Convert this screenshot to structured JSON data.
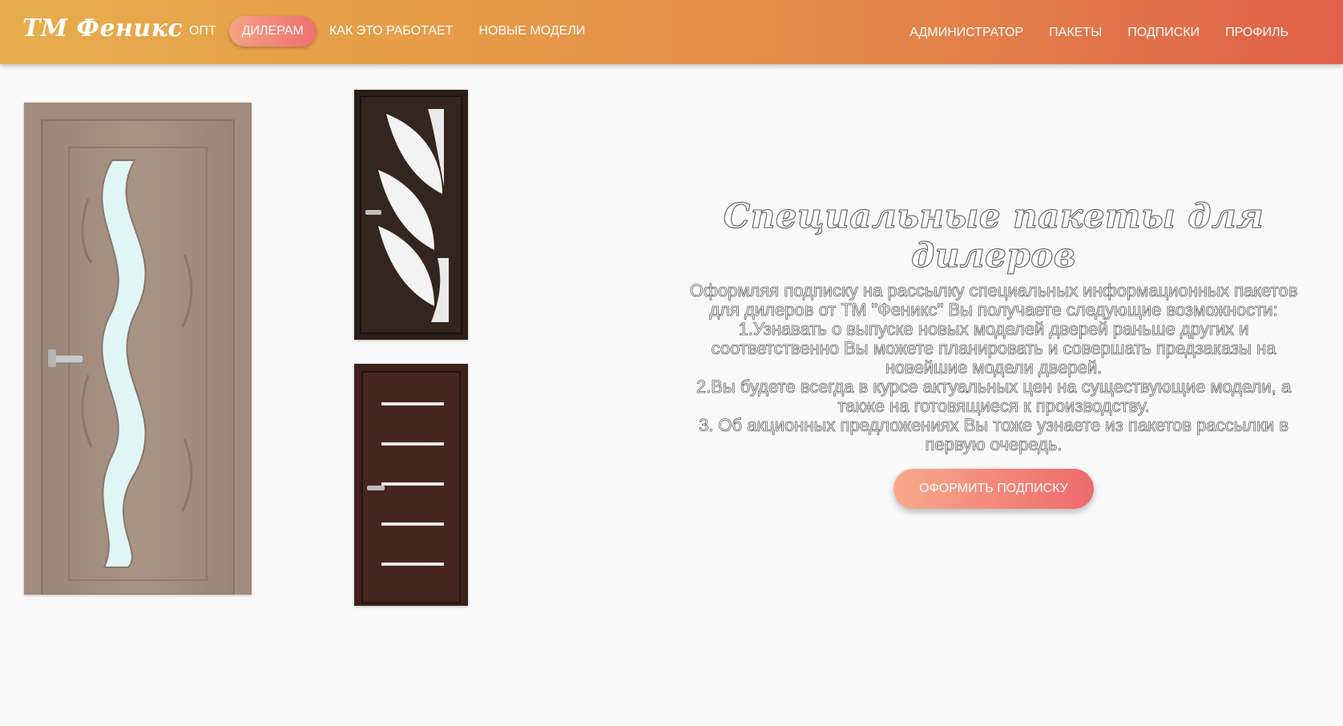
{
  "brand": {
    "name": "ТМ Феникс"
  },
  "nav_left": [
    {
      "label": "ОПТ",
      "active": false
    },
    {
      "label": "ДИЛЕРАМ",
      "active": true
    },
    {
      "label": "КАК ЭТО РАБОТАЕТ",
      "active": false
    },
    {
      "label": "НОВЫЕ МОДЕЛИ",
      "active": false
    }
  ],
  "nav_right": [
    {
      "label": "АДМИНИСТРАТОР"
    },
    {
      "label": "ПАКЕТЫ"
    },
    {
      "label": "ПОДПИСКИ"
    },
    {
      "label": "ПРОФИЛЬ"
    }
  ],
  "main": {
    "title": "Специальные пакеты для дилеров",
    "paragraphs": [
      "Оформляя подписку на рассылку специальных информационных пакетов для дилеров от ТМ \"Феникс\" Вы получаете следующие возможности:",
      "1.Узнавать о выпуске новых моделей дверей раньше других и соответственно Вы можете планировать и совершать предзаказы на новейшие модели дверей.",
      "2.Вы будете всегда в курсе актуальных цен на существующие модели, а также на готовящиеся к производству.",
      "3. Об акционных предложениях Вы тоже узнаете из пакетов рассылки в первую очередь."
    ],
    "cta_label": "ОФОРМИТЬ ПОДПИСКУ"
  },
  "colors": {
    "header_start": "#e7ad4c",
    "header_end": "#df6049",
    "accent_start": "#f8a98a",
    "accent_end": "#ee6a6c",
    "background": "#f9f9f9"
  }
}
